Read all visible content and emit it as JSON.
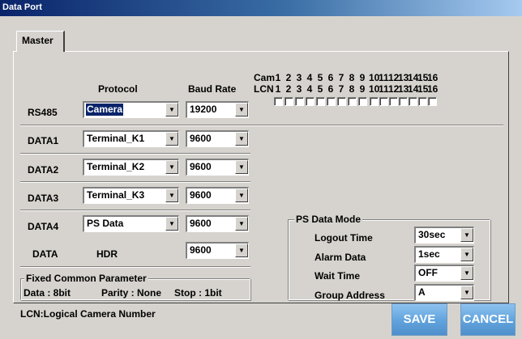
{
  "window": {
    "title": "Data Port"
  },
  "tab": {
    "label": "Master"
  },
  "headers": {
    "protocol": "Protocol",
    "baud_rate": "Baud Rate",
    "cam": "Cam",
    "lcn": "LCN"
  },
  "channels": [
    "1",
    "2",
    "3",
    "4",
    "5",
    "6",
    "7",
    "8",
    "9",
    "10",
    "11",
    "12",
    "13",
    "14",
    "15",
    "16"
  ],
  "rows": {
    "rs485": {
      "label": "RS485",
      "protocol": "Camera",
      "baud": "19200"
    },
    "data1": {
      "label": "DATA1",
      "protocol": "Terminal_K1",
      "baud": "9600"
    },
    "data2": {
      "label": "DATA2",
      "protocol": "Terminal_K2",
      "baud": "9600"
    },
    "data3": {
      "label": "DATA3",
      "protocol": "Terminal_K3",
      "baud": "9600"
    },
    "data4": {
      "label": "DATA4",
      "protocol": "PS Data",
      "baud": "9600"
    },
    "hdr": {
      "label": "DATA",
      "sublabel": "HDR",
      "baud": "9600"
    }
  },
  "fixed": {
    "title": "Fixed Common Parameter",
    "data": "Data : 8bit",
    "parity": "Parity : None",
    "stop": "Stop : 1bit"
  },
  "ps_mode": {
    "title": "PS Data Mode",
    "logout_label": "Logout Time",
    "logout_value": "30sec",
    "alarm_label": "Alarm Data",
    "alarm_value": "1sec",
    "wait_label": "Wait Time",
    "wait_value": "OFF",
    "group_label": "Group Address",
    "group_value": "A"
  },
  "footer": {
    "note": "LCN:Logical Camera Number",
    "save": "SAVE",
    "cancel": "CANCEL"
  },
  "icons": {
    "dropdown": "chevron-down-icon"
  },
  "colors": {
    "title_bar": "#0a246a",
    "button": "#63a5de",
    "selection": "#0a246a"
  }
}
